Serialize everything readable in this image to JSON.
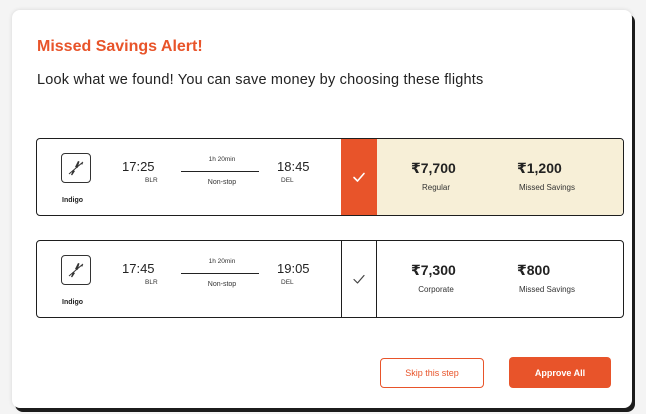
{
  "alert": {
    "title": "Missed Savings Alert!",
    "message": "Look what we found! You can save money by choosing these flights"
  },
  "flights": [
    {
      "airline": "Indigo",
      "logo_icon": "airplane-takeoff-icon",
      "departure_time": "17:25",
      "departure_code": "BLR",
      "duration": "1h 20min",
      "stops": "Non-stop",
      "arrival_time": "18:45",
      "arrival_code": "DEL",
      "selected": true,
      "fare_price": "₹7,700",
      "fare_type": "Regular",
      "missed_savings": "₹1,200",
      "missed_label": "Missed Savings"
    },
    {
      "airline": "Indigo",
      "logo_icon": "airplane-takeoff-icon",
      "departure_time": "17:45",
      "departure_code": "BLR",
      "duration": "1h 20min",
      "stops": "Non-stop",
      "arrival_time": "19:05",
      "arrival_code": "DEL",
      "selected": false,
      "fare_price": "₹7,300",
      "fare_type": "Corporate",
      "missed_savings": "₹800",
      "missed_label": "Missed Savings"
    }
  ],
  "actions": {
    "skip_label": "Skip this step",
    "approve_label": "Approve All"
  },
  "colors": {
    "accent": "#e8542a",
    "highlight": "#f7efd7",
    "border": "#1e1e1e"
  }
}
